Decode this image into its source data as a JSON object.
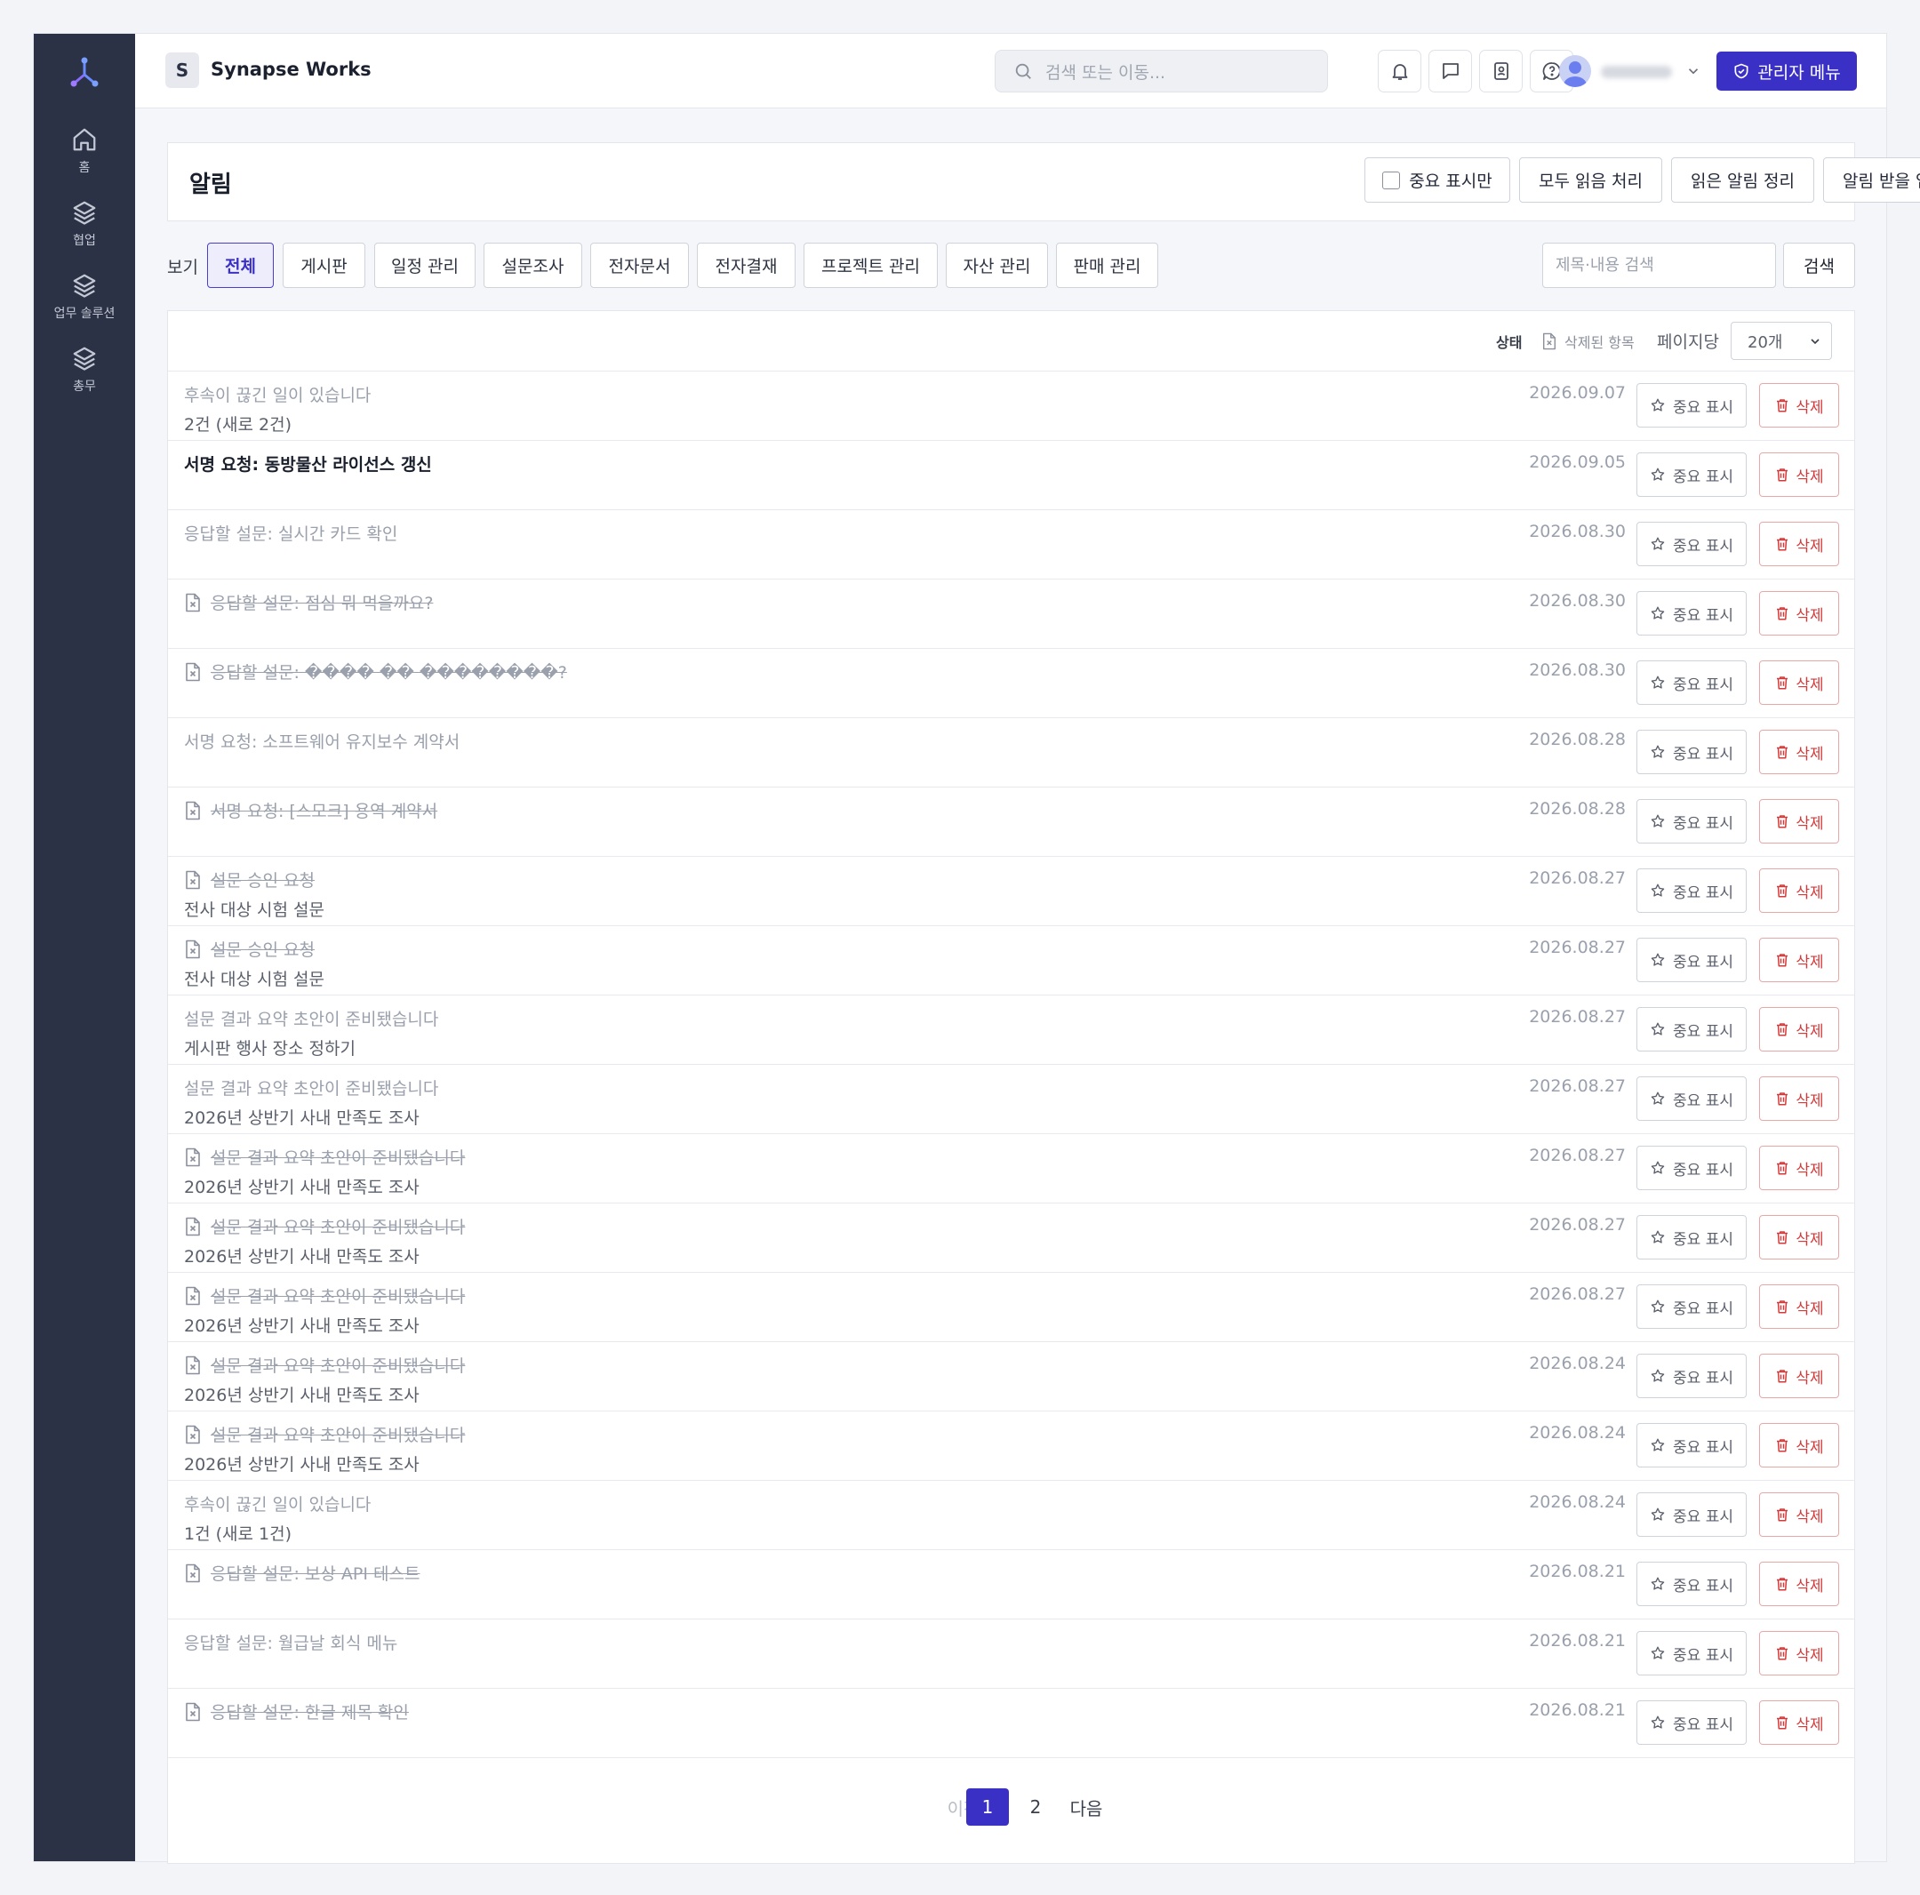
{
  "sidebar": {
    "items": [
      {
        "label": "홈",
        "icon": "home-icon"
      },
      {
        "label": "협업",
        "icon": "layers-icon"
      },
      {
        "label": "업무 솔루션",
        "icon": "layers-icon"
      },
      {
        "label": "총무",
        "icon": "layers-icon"
      }
    ]
  },
  "header": {
    "workspace_initial": "S",
    "workspace_name": "Synapse Works",
    "search_placeholder": "검색 또는 이동...",
    "admin_label": "관리자 메뉴"
  },
  "page": {
    "title": "알림",
    "actions": {
      "important_only": "중요 표시만",
      "mark_all_read": "모두 읽음 처리",
      "clear_read": "읽은 알림 정리",
      "subscribed": "알림 받을 업무"
    }
  },
  "filters": {
    "view_label": "보기",
    "tabs": [
      "전체",
      "게시판",
      "일정 관리",
      "설문조사",
      "전자문서",
      "전자결재",
      "프로젝트 관리",
      "자산 관리",
      "판매 관리"
    ],
    "active_index": 0,
    "search_placeholder": "제목·내용 검색",
    "search_button": "검색"
  },
  "toolbar": {
    "status_label": "상태",
    "deleted_label": "삭제된 항목",
    "per_page_label": "페이지당",
    "per_page_value": "20개"
  },
  "row_actions": {
    "important": "중요 표시",
    "delete": "삭제"
  },
  "notifications": [
    {
      "title": "후속이 끊긴 일이 있습니다",
      "subtitle": "2건 (새로 2건)",
      "date": "2026.09.07",
      "state": "read"
    },
    {
      "title": "서명 요청: 동방물산 라이선스 갱신",
      "subtitle": "",
      "date": "2026.09.05",
      "state": "unread"
    },
    {
      "title": "응답할 설문: 실시간 카드 확인",
      "subtitle": "",
      "date": "2026.08.30",
      "state": "read"
    },
    {
      "title": "응답할 설문: 점심 뭐 먹을까요?",
      "subtitle": "",
      "date": "2026.08.30",
      "state": "deleted"
    },
    {
      "title": "응답할 설문: ���� �� ��������?",
      "subtitle": "",
      "date": "2026.08.30",
      "state": "deleted"
    },
    {
      "title": "서명 요청: 소프트웨어 유지보수 계약서",
      "subtitle": "",
      "date": "2026.08.28",
      "state": "read"
    },
    {
      "title": "서명 요청: [스모크] 용역 계약서",
      "subtitle": "",
      "date": "2026.08.28",
      "state": "deleted"
    },
    {
      "title": "설문 승인 요청",
      "subtitle": "전사 대상 시험 설문",
      "date": "2026.08.27",
      "state": "deleted"
    },
    {
      "title": "설문 승인 요청",
      "subtitle": "전사 대상 시험 설문",
      "date": "2026.08.27",
      "state": "deleted"
    },
    {
      "title": "설문 결과 요약 초안이 준비됐습니다",
      "subtitle": "게시판 행사 장소 정하기",
      "date": "2026.08.27",
      "state": "read"
    },
    {
      "title": "설문 결과 요약 초안이 준비됐습니다",
      "subtitle": "2026년 상반기 사내 만족도 조사",
      "date": "2026.08.27",
      "state": "read"
    },
    {
      "title": "설문 결과 요약 초안이 준비됐습니다",
      "subtitle": "2026년 상반기 사내 만족도 조사",
      "date": "2026.08.27",
      "state": "deleted"
    },
    {
      "title": "설문 결과 요약 초안이 준비됐습니다",
      "subtitle": "2026년 상반기 사내 만족도 조사",
      "date": "2026.08.27",
      "state": "deleted"
    },
    {
      "title": "설문 결과 요약 초안이 준비됐습니다",
      "subtitle": "2026년 상반기 사내 만족도 조사",
      "date": "2026.08.27",
      "state": "deleted"
    },
    {
      "title": "설문 결과 요약 초안이 준비됐습니다",
      "subtitle": "2026년 상반기 사내 만족도 조사",
      "date": "2026.08.24",
      "state": "deleted"
    },
    {
      "title": "설문 결과 요약 초안이 준비됐습니다",
      "subtitle": "2026년 상반기 사내 만족도 조사",
      "date": "2026.08.24",
      "state": "deleted"
    },
    {
      "title": "후속이 끊긴 일이 있습니다",
      "subtitle": "1건 (새로 1건)",
      "date": "2026.08.24",
      "state": "read"
    },
    {
      "title": "응답할 설문: 보상 API 테스트",
      "subtitle": "",
      "date": "2026.08.21",
      "state": "deleted"
    },
    {
      "title": "응답할 설문: 월급날 회식 메뉴",
      "subtitle": "",
      "date": "2026.08.21",
      "state": "read"
    },
    {
      "title": "응답할 설문: 한글 제목 확인",
      "subtitle": "",
      "date": "2026.08.21",
      "state": "deleted"
    }
  ],
  "pagination": {
    "prev": "이전",
    "pages": [
      "1",
      "2"
    ],
    "current": "1",
    "next": "다음"
  },
  "colors": {
    "accent": "#3b30c6",
    "sidebar": "#2b3245",
    "danger": "#d53a3a"
  }
}
